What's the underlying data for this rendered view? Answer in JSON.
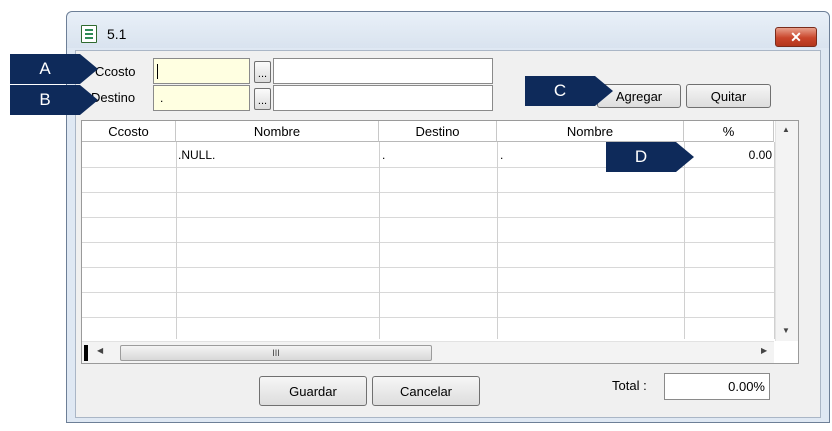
{
  "window": {
    "title": "5.1",
    "close_label": "✕"
  },
  "form": {
    "ccosto_label": "Ccosto",
    "ccosto_value": "",
    "destino_label": "Destino",
    "destino_value": ".",
    "browse_label": "...",
    "ccosto_desc": "",
    "destino_desc": ""
  },
  "actions": {
    "agregar": "Agregar",
    "quitar": "Quitar",
    "guardar": "Guardar",
    "cancelar": "Cancelar"
  },
  "grid": {
    "columns": [
      "Ccosto",
      "Nombre",
      "Destino",
      "Nombre",
      "%"
    ],
    "rows": [
      [
        "",
        ".NULL.",
        ".",
        ".",
        "0.00"
      ]
    ],
    "hscroll_grip": "III",
    "scroll_up": "▲",
    "scroll_down": "▼",
    "scroll_left": "◀",
    "scroll_right": "▶"
  },
  "total": {
    "label": "Total :",
    "value": "0.00%"
  },
  "callouts": {
    "a": "A",
    "b": "B",
    "c": "C",
    "d": "D"
  }
}
